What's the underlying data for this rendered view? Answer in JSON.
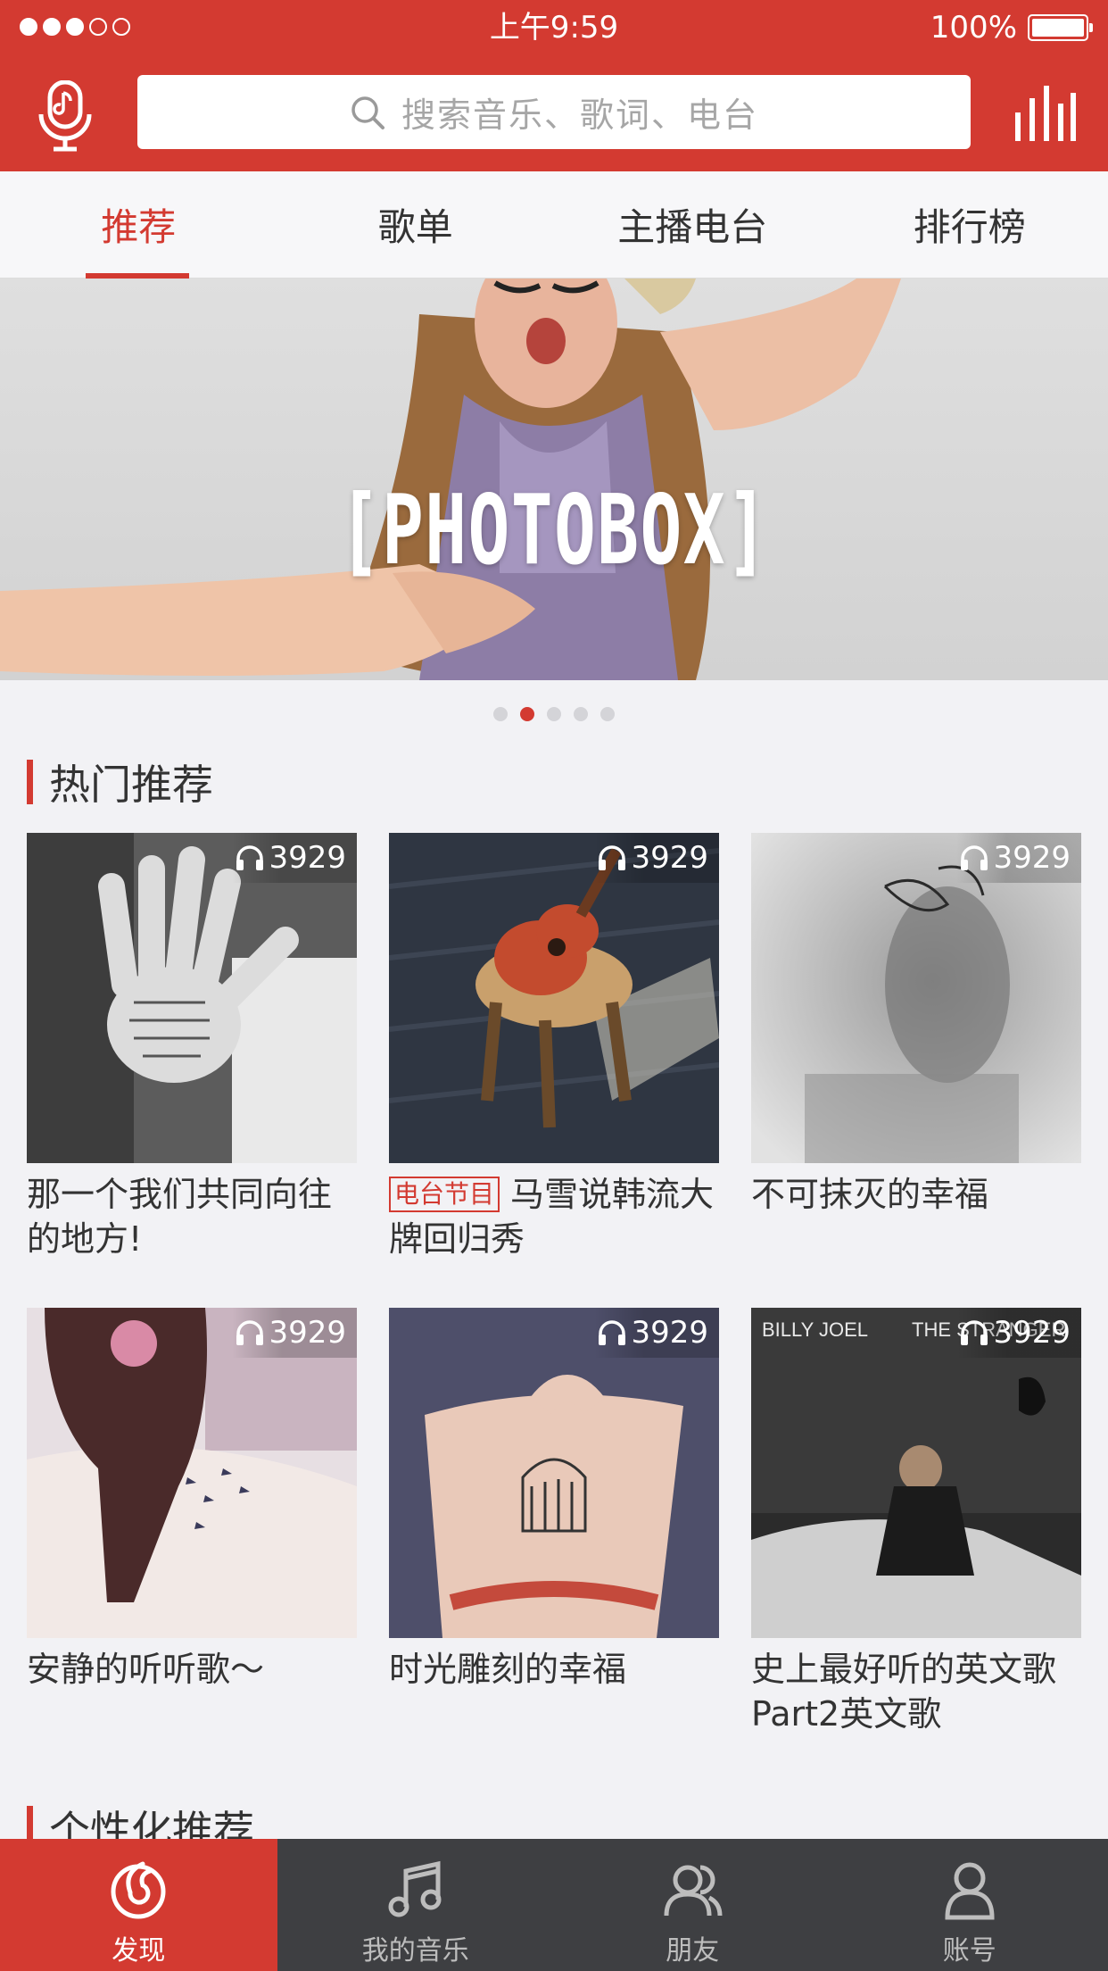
{
  "status_bar": {
    "time": "上午9:59",
    "battery": "100%"
  },
  "header": {
    "search_placeholder": "搜索音乐、歌词、电台"
  },
  "tabs": [
    {
      "label": "推荐"
    },
    {
      "label": "歌单"
    },
    {
      "label": "主播电台"
    },
    {
      "label": "排行榜"
    }
  ],
  "active_tab": "推荐",
  "banner": {
    "text": "[PHOTOBOX]",
    "page_count": 5,
    "current_page": 2
  },
  "hot": {
    "title": "热门推荐",
    "items": [
      {
        "count": "3929",
        "title": "那一个我们共同向往的地方!"
      },
      {
        "count": "3929",
        "tag": "电台节目",
        "title": "马雪说韩流大牌回归秀"
      },
      {
        "count": "3929",
        "title": "不可抹灭的幸福"
      },
      {
        "count": "3929",
        "title": "安静的听听歌～"
      },
      {
        "count": "3929",
        "title": "时光雕刻的幸福"
      },
      {
        "count": "3929",
        "title": "史上最好听的英文歌Part2英文歌",
        "cover_left": "BILLY JOEL",
        "cover_right": "THE STRANGER"
      }
    ]
  },
  "personal": {
    "title": "个性化推荐"
  },
  "bottom_nav": [
    {
      "label": "发现",
      "icon": "discover-icon"
    },
    {
      "label": "我的音乐",
      "icon": "music-note-icon"
    },
    {
      "label": "朋友",
      "icon": "friends-icon"
    },
    {
      "label": "账号",
      "icon": "account-icon"
    }
  ],
  "colors": {
    "accent": "#d33a31",
    "nav_bg": "#3e3f42",
    "page_bg": "#f2f2f5"
  }
}
